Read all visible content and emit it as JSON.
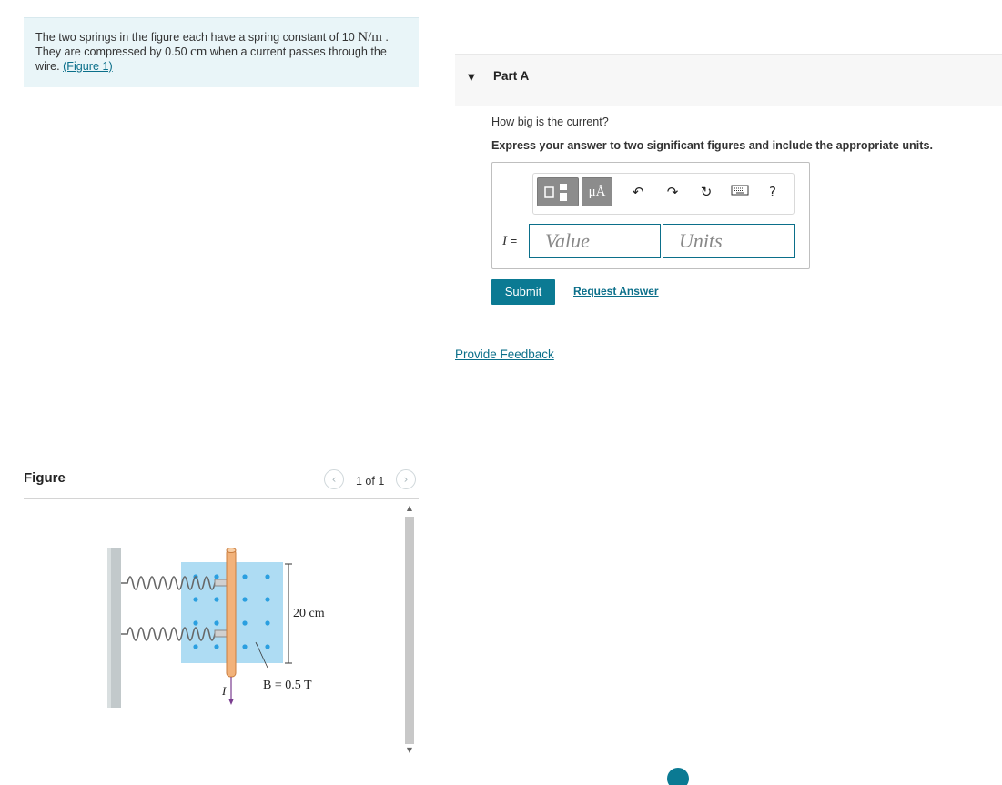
{
  "problem": {
    "text_1": "The two springs in the figure each have a spring constant of 10 ",
    "unit_1": "N/m",
    "text_2": " . They are compressed by 0.50 ",
    "unit_2": "cm",
    "text_3": " when a current passes through the wire. ",
    "figure_link": "(Figure 1)"
  },
  "figure_panel": {
    "title": "Figure",
    "pager_text": "1 of 1",
    "prev_icon": "chevron-left-icon",
    "next_icon": "chevron-right-icon",
    "labels": {
      "length": "20 cm",
      "field": "B = 0.5 T",
      "current": "I"
    }
  },
  "part": {
    "title": "Part A",
    "question": "How big is the current?",
    "instructions": "Express your answer to two significant figures and include the appropriate units.",
    "toolbar": {
      "units_button": "μÅ",
      "help": "?"
    },
    "equation_label": "I",
    "equals": " =",
    "value_placeholder": "Value",
    "units_placeholder": "Units",
    "submit_label": "Submit",
    "request_answer_label": "Request Answer"
  },
  "feedback_label": "Provide Feedback",
  "colors": {
    "accent": "#0b7a93",
    "link": "#0b6f8a",
    "problem_bg": "#e9f5f8",
    "field_blue": "#aedcf3",
    "dot_blue": "#2a9fe0"
  }
}
